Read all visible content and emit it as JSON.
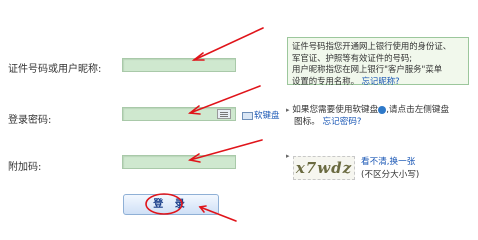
{
  "form": {
    "id_label": "证件号码或用户昵称:",
    "password_label": "登录密码:",
    "extra_code_label": "附加码:",
    "soft_keyboard_label": "软键盘",
    "login_button": "登 录"
  },
  "tips": {
    "id_tip_line1": "证件号码指您开通网上银行使用的身份证、",
    "id_tip_line2": "军官证、护照等有效证件的号码;",
    "id_tip_line3": "用户昵称指您在网上银行\"客户服务\"菜单",
    "id_tip_line4_prefix": "设置的专用名称。",
    "forgot_nickname": "忘记昵称?",
    "password_tip_line1": "如果您需要使用软键盘",
    "password_tip_line1b": ",请点击左侧键盘",
    "password_tip_line2": "图标。",
    "forgot_password": "忘记密码?",
    "captcha_text": "x7wdz",
    "refresh_captcha": "看不清,换一张",
    "case_insensitive": "(不区分大小写)"
  },
  "colors": {
    "input_bg": "#cfe8cf",
    "annotation_red": "#e0141a",
    "link_blue": "#1a57b5"
  }
}
